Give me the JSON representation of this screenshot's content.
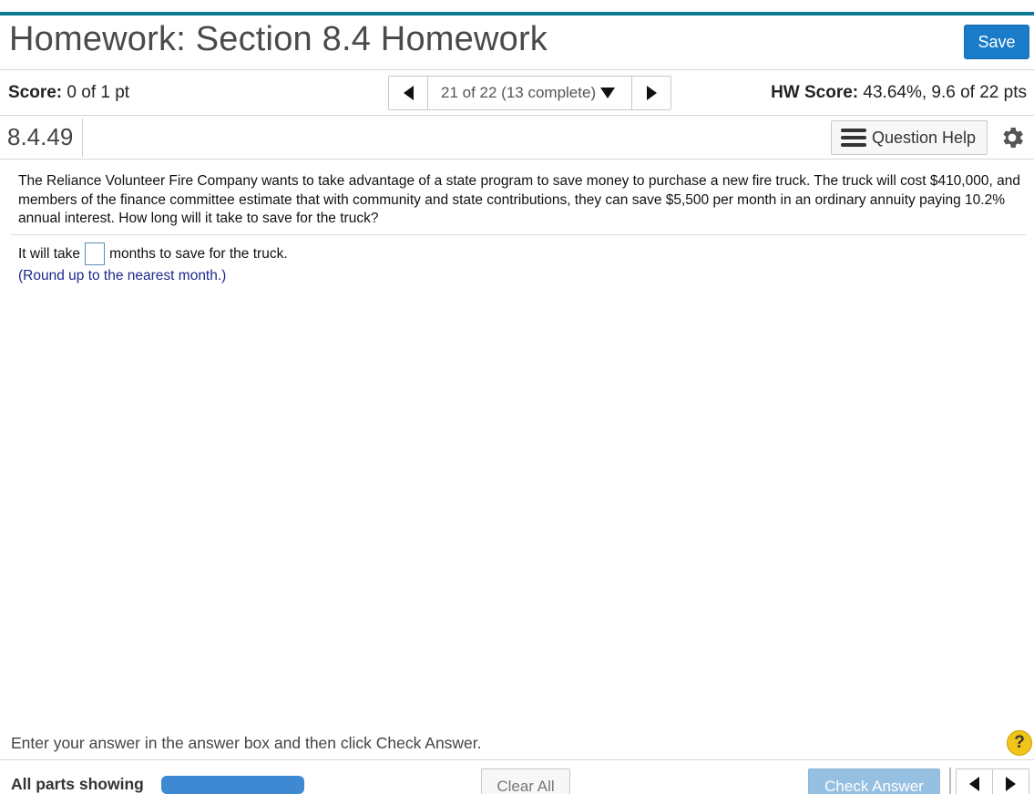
{
  "header": {
    "title": "Homework: Section 8.4 Homework",
    "save_label": "Save"
  },
  "score_bar": {
    "score_label": "Score:",
    "score_value": "0 of 1 pt",
    "nav_label": "21 of 22 (13 complete)",
    "hw_score_label": "HW Score:",
    "hw_score_value": "43.64%, 9.6 of 22 pts"
  },
  "question_bar": {
    "number": "8.4.49",
    "help_label": "Question Help"
  },
  "question": {
    "text": "The Reliance Volunteer Fire Company wants to take advantage of a state program to save money to purchase a new fire truck. The truck will cost $410,000, and members of the finance committee estimate that with community and state contributions, they can save $5,500 per month in an ordinary annuity paying 10.2% annual interest. How long will it take to save for the truck?",
    "answer_prefix": "It will take",
    "answer_value": "",
    "answer_suffix": "months to save for the truck.",
    "hint": "(Round up to the nearest month.)"
  },
  "footer": {
    "instructions": "Enter your answer in the answer box and then click Check Answer.",
    "help_symbol": "?",
    "parts_label": "All parts showing",
    "progress_fraction": 1.0,
    "clear_label": "Clear All",
    "check_label": "Check Answer"
  },
  "colors": {
    "accent_bar": "#0b7a94",
    "save_button": "#1a7bc9",
    "hint_text": "#1e2a8c",
    "progress_fill": "#3f89d3",
    "check_button_disabled": "#96c0e2",
    "help_circle": "#f0c419"
  },
  "icons": {
    "prev": "triangle-left-icon",
    "next": "triangle-right-icon",
    "dropdown": "triangle-down-icon",
    "help_list": "list-icon",
    "settings": "gear-icon",
    "help": "question-circle-icon"
  }
}
